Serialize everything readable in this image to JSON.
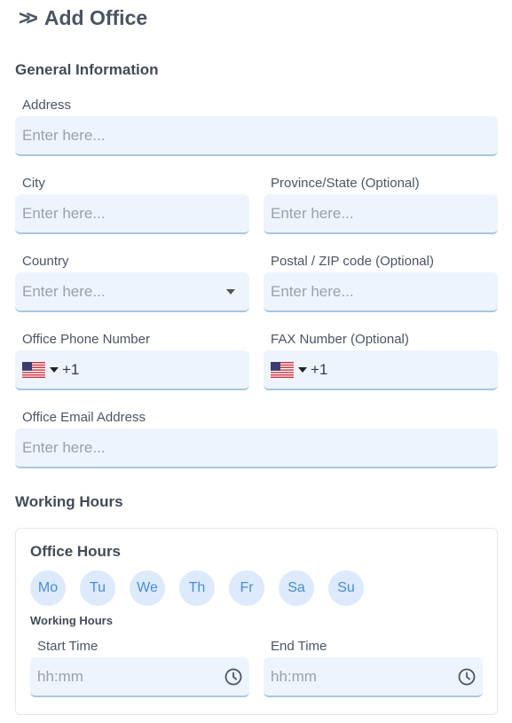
{
  "page": {
    "title": "Add Office"
  },
  "general": {
    "section_title": "General Information",
    "address": {
      "label": "Address",
      "placeholder": "Enter here..."
    },
    "city": {
      "label": "City",
      "placeholder": "Enter here..."
    },
    "province": {
      "label": "Province/State (Optional)",
      "placeholder": "Enter here..."
    },
    "country": {
      "label": "Country",
      "placeholder": "Enter here..."
    },
    "postal": {
      "label": "Postal / ZIP code (Optional)",
      "placeholder": "Enter here..."
    },
    "office_phone": {
      "label": "Office Phone Number",
      "code": "+1",
      "flag": "us-flag-icon"
    },
    "fax": {
      "label": "FAX Number (Optional)",
      "code": "+1",
      "flag": "us-flag-icon"
    },
    "email": {
      "label": "Office Email Address",
      "placeholder": "Enter here..."
    }
  },
  "working": {
    "section_title": "Working Hours",
    "card_title": "Office Hours",
    "days": [
      "Mo",
      "Tu",
      "We",
      "Th",
      "Fr",
      "Sa",
      "Su"
    ],
    "sub_label": "Working Hours",
    "start": {
      "label": "Start Time",
      "placeholder": "hh:mm"
    },
    "end": {
      "label": "End Time",
      "placeholder": "hh:mm"
    }
  },
  "colors": {
    "field_bg": "#edf4fe",
    "field_border": "#a8c6e0",
    "day_bg": "#dceafb",
    "day_text": "#4a8dd4"
  }
}
